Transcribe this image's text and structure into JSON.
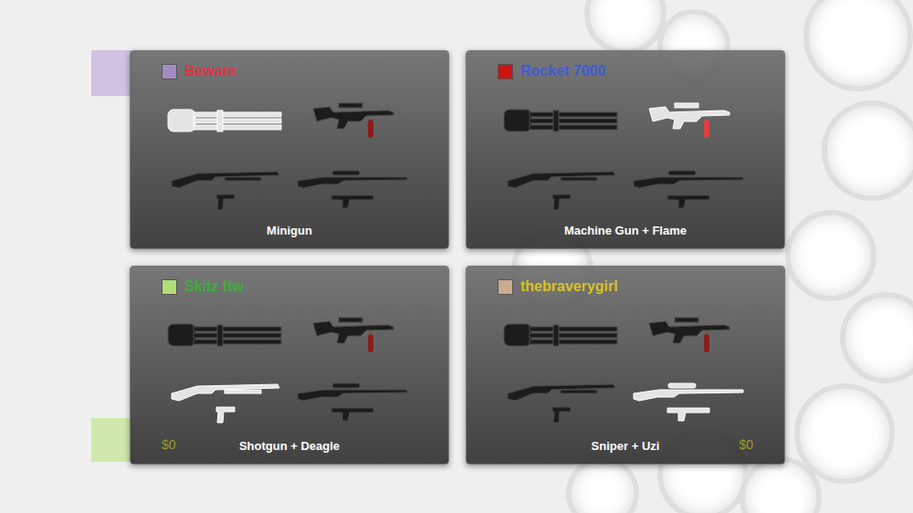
{
  "players": [
    {
      "name": "Beware",
      "name_color": "#e03346",
      "color": "#a48bc4",
      "label": "Minigun",
      "money": "",
      "slots": [
        {
          "weapons": [
            {
              "kind": "minigun",
              "selected": true
            }
          ]
        },
        {
          "weapons": [
            {
              "kind": "rifle",
              "selected": false
            }
          ]
        },
        {
          "weapons": [
            {
              "kind": "shotgun",
              "selected": false
            },
            {
              "kind": "pistol",
              "selected": false
            }
          ]
        },
        {
          "weapons": [
            {
              "kind": "sniper",
              "selected": false
            },
            {
              "kind": "uzi",
              "selected": false
            }
          ]
        }
      ]
    },
    {
      "name": "Rocket 7000",
      "name_color": "#3d5bd6",
      "color": "#cc1414",
      "label": "Machine Gun + Flame",
      "money": "",
      "slots": [
        {
          "weapons": [
            {
              "kind": "minigun",
              "selected": false
            }
          ]
        },
        {
          "weapons": [
            {
              "kind": "rifle",
              "selected": true
            }
          ]
        },
        {
          "weapons": [
            {
              "kind": "shotgun",
              "selected": false
            },
            {
              "kind": "pistol",
              "selected": false
            }
          ]
        },
        {
          "weapons": [
            {
              "kind": "sniper",
              "selected": false
            },
            {
              "kind": "uzi",
              "selected": false
            }
          ]
        }
      ]
    },
    {
      "name": "Skitz ftw",
      "name_color": "#3fae3a",
      "color": "#b2de78",
      "label": "Shotgun + Deagle",
      "money": "$0",
      "slots": [
        {
          "weapons": [
            {
              "kind": "minigun",
              "selected": false
            }
          ]
        },
        {
          "weapons": [
            {
              "kind": "rifle",
              "selected": false
            }
          ]
        },
        {
          "weapons": [
            {
              "kind": "shotgun",
              "selected": true
            },
            {
              "kind": "pistol",
              "selected": true
            }
          ]
        },
        {
          "weapons": [
            {
              "kind": "sniper",
              "selected": false
            },
            {
              "kind": "uzi",
              "selected": false
            }
          ]
        }
      ]
    },
    {
      "name": "thebraverygirl",
      "name_color": "#d8c321",
      "color": "#c9aa93",
      "label": "Sniper + Uzi",
      "money": "$0",
      "slots": [
        {
          "weapons": [
            {
              "kind": "minigun",
              "selected": false
            }
          ]
        },
        {
          "weapons": [
            {
              "kind": "rifle",
              "selected": false
            }
          ]
        },
        {
          "weapons": [
            {
              "kind": "shotgun",
              "selected": false
            },
            {
              "kind": "pistol",
              "selected": false
            }
          ]
        },
        {
          "weapons": [
            {
              "kind": "sniper",
              "selected": true
            },
            {
              "kind": "uzi",
              "selected": true
            }
          ]
        }
      ]
    }
  ]
}
